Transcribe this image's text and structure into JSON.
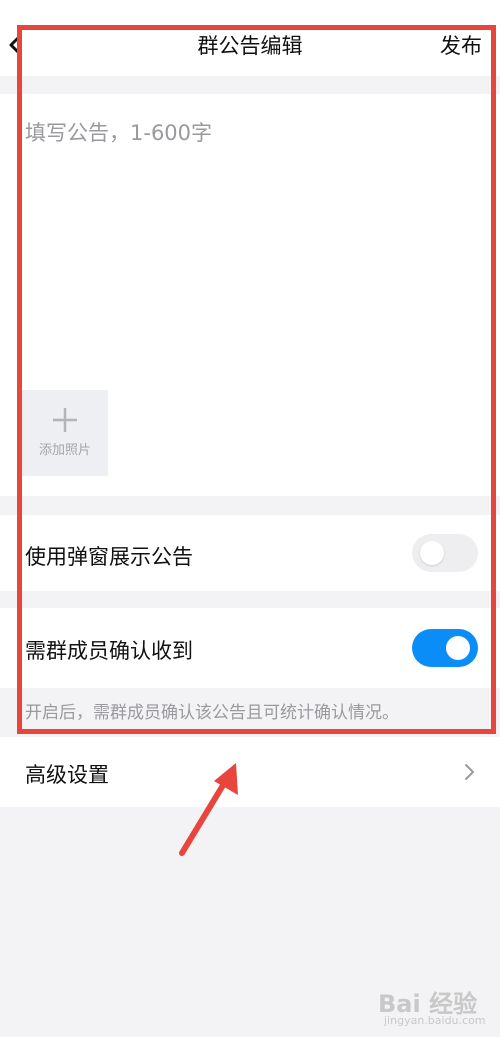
{
  "header": {
    "title": "群公告编辑",
    "publish_label": "发布",
    "back_icon": "chevron-left-icon"
  },
  "editor": {
    "placeholder": "填写公告，1-600字",
    "add_photo_label": "添加照片",
    "add_photo_icon": "plus-icon"
  },
  "settings": {
    "popup_label": "使用弹窗展示公告",
    "popup_enabled": false,
    "confirm_label": "需群成员确认收到",
    "confirm_enabled": true,
    "confirm_hint": "开启后，需群成员确认该公告且可统计确认情况。",
    "advanced_label": "高级设置",
    "advanced_icon": "chevron-right-icon"
  },
  "annotation": {
    "color": "#e8453c"
  },
  "watermark": {
    "brand": "Bai 经验",
    "sub": "jingyan.baidu.com"
  },
  "colors": {
    "accent": "#0a8df6",
    "background": "#f3f3f5",
    "placeholder": "#9a9a9e"
  }
}
